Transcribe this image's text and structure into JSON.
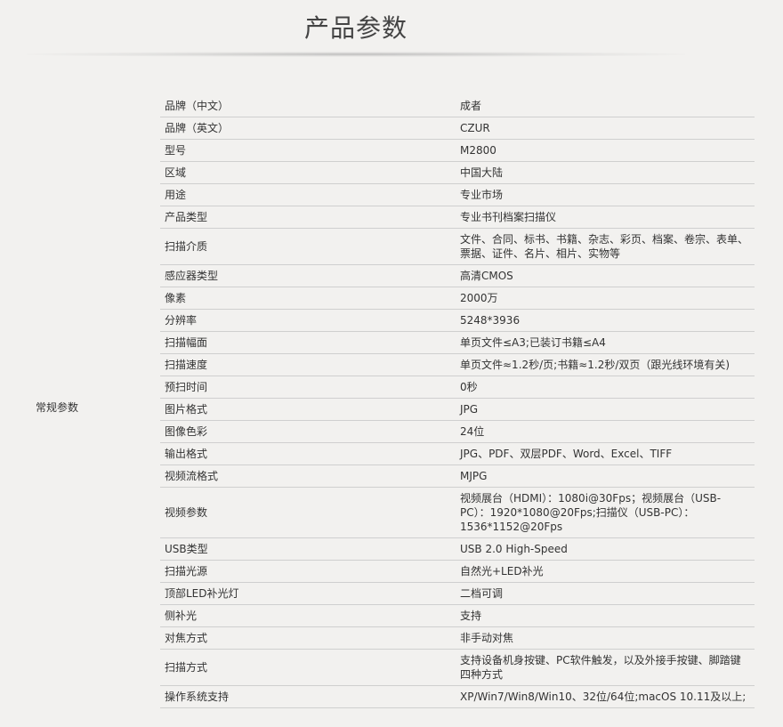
{
  "page": {
    "title": "产品参数",
    "group_label": "常规参数"
  },
  "specs": [
    {
      "key": "品牌（中文）",
      "value": "成者"
    },
    {
      "key": "品牌（英文）",
      "value": "CZUR"
    },
    {
      "key": "型号",
      "value": "M2800"
    },
    {
      "key": "区域",
      "value": "中国大陆"
    },
    {
      "key": "用途",
      "value": "专业市场"
    },
    {
      "key": "产品类型",
      "value": "专业书刊档案扫描仪"
    },
    {
      "key": "扫描介质",
      "value": "文件、合同、标书、书籍、杂志、彩页、档案、卷宗、表单、票据、证件、名片、相片、实物等"
    },
    {
      "key": "感应器类型",
      "value": "高清CMOS"
    },
    {
      "key": "像素",
      "value": "2000万"
    },
    {
      "key": "分辨率",
      "value": "5248*3936"
    },
    {
      "key": "扫描幅面",
      "value": "单页文件≤A3;已装订书籍≤A4"
    },
    {
      "key": "扫描速度",
      "value": "单页文件≈1.2秒/页;书籍≈1.2秒/双页（跟光线环境有关)"
    },
    {
      "key": "预扫时间",
      "value": "0秒"
    },
    {
      "key": "图片格式",
      "value": "JPG"
    },
    {
      "key": "图像色彩",
      "value": "24位"
    },
    {
      "key": "输出格式",
      "value": "JPG、PDF、双层PDF、Word、Excel、TIFF"
    },
    {
      "key": "视频流格式",
      "value": "MJPG"
    },
    {
      "key": "视频参数",
      "value": "视频展台（HDMI）：1080i@30Fps；视频展台（USB-PC）：1920*1080@20Fps;扫描仪（USB-PC）：1536*1152@20Fps"
    },
    {
      "key": "USB类型",
      "value": "USB 2.0 High-Speed"
    },
    {
      "key": "扫描光源",
      "value": "自然光+LED补光"
    },
    {
      "key": "顶部LED补光灯",
      "value": "二档可调"
    },
    {
      "key": "侧补光",
      "value": "支持"
    },
    {
      "key": "对焦方式",
      "value": "非手动对焦"
    },
    {
      "key": "扫描方式",
      "value": "支持设备机身按键、PC软件触发，以及外接手按键、脚踏键四种方式"
    },
    {
      "key": "操作系统支持",
      "value": "XP/Win7/Win8/Win10、32位/64位;macOS 10.11及以上;"
    }
  ]
}
